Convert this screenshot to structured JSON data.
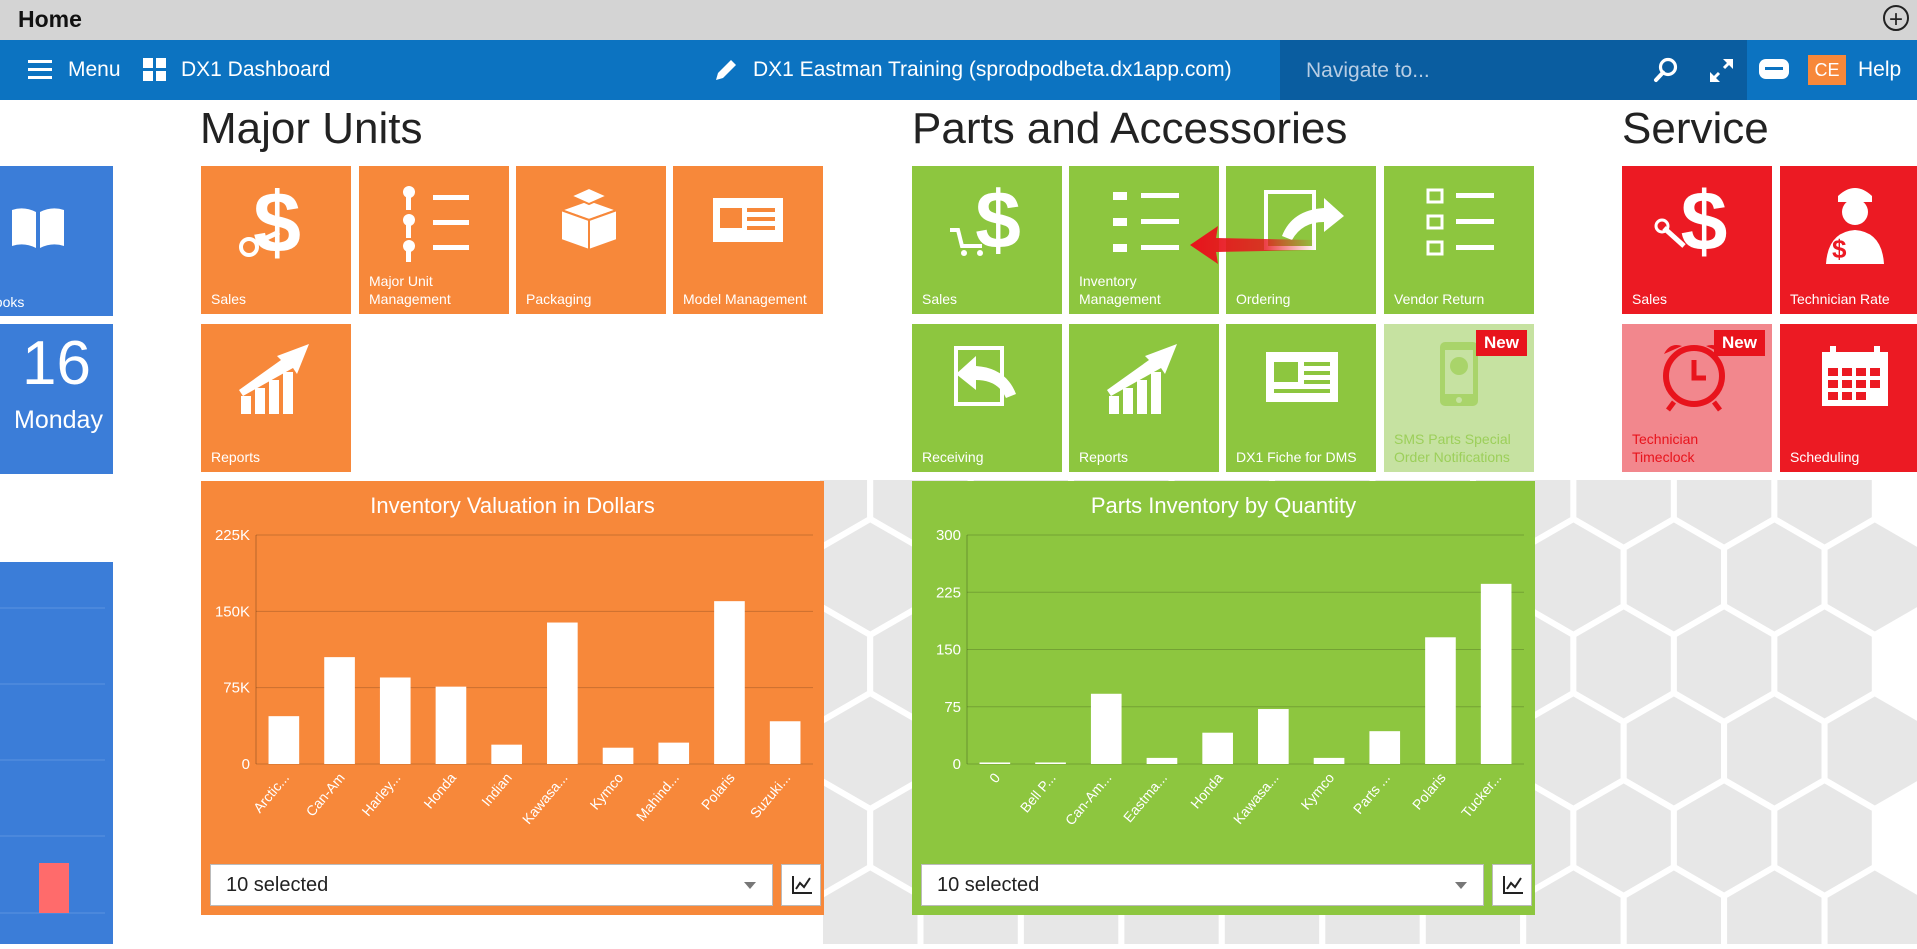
{
  "window": {
    "title": "Home",
    "add_icon": "plus-circle-icon"
  },
  "navbar": {
    "menu_label": "Menu",
    "dashboard_label": "DX1 Dashboard",
    "account_label": "DX1 Eastman Training (sprodpodbeta.dx1app.com)",
    "search_placeholder": "Navigate to...",
    "avatar_initials": "CE",
    "help_label": "Help",
    "icons": [
      "hamburger-icon",
      "grid-icon",
      "pencil-icon",
      "search-icon",
      "expand-icon",
      "chat-icon"
    ]
  },
  "left_panel": {
    "books_label": "books",
    "date_day": "16",
    "date_weekday": "Monday"
  },
  "sections": {
    "major_units": {
      "title": "Major Units",
      "tiles": [
        {
          "label": "Sales",
          "icon": "dollar-key-icon"
        },
        {
          "label": "Major Unit Management",
          "icon": "key-list-icon"
        },
        {
          "label": "Packaging",
          "icon": "boxes-icon"
        },
        {
          "label": "Model Management",
          "icon": "vehicle-card-icon"
        },
        {
          "label": "Reports",
          "icon": "growth-chart-icon"
        }
      ]
    },
    "parts": {
      "title": "Parts and Accessories",
      "tiles": [
        {
          "label": "Sales",
          "icon": "dollar-cart-icon"
        },
        {
          "label": "Inventory Management",
          "icon": "cart-list-icon"
        },
        {
          "label": "Ordering",
          "icon": "cart-forward-icon"
        },
        {
          "label": "Vendor Return",
          "icon": "return-list-icon"
        },
        {
          "label": "Receiving",
          "icon": "cart-back-icon"
        },
        {
          "label": "Reports",
          "icon": "growth-chart-icon"
        },
        {
          "label": "DX1 Fiche for DMS",
          "icon": "newspaper-icon"
        },
        {
          "label": "SMS Parts Special Order Notifications",
          "icon": "sms-phone-icon",
          "badge": "New"
        }
      ]
    },
    "service": {
      "title": "Service",
      "tiles": [
        {
          "label": "Sales",
          "icon": "dollar-wrench-icon"
        },
        {
          "label": "Technician Rate",
          "icon": "technician-icon"
        },
        {
          "label": "Technician Timeclock",
          "icon": "alarm-clock-icon",
          "badge": "New"
        },
        {
          "label": "Scheduling",
          "icon": "calendar-icon"
        }
      ]
    }
  },
  "charts": {
    "inventory_dollars": {
      "select_text": "10 selected",
      "button_icon": "line-chart-icon"
    },
    "parts_quantity": {
      "select_text": "10 selected",
      "button_icon": "line-chart-icon"
    }
  },
  "chart_data": [
    {
      "type": "bar",
      "title": "Inventory Valuation in Dollars",
      "categories": [
        "Arctic...",
        "Can-Am",
        "Harley...",
        "Honda",
        "Indian",
        "Kawasa...",
        "Kymco",
        "Mahind...",
        "Polaris",
        "Suzuki..."
      ],
      "values": [
        47000,
        105000,
        85000,
        76000,
        19000,
        139000,
        16000,
        21000,
        160000,
        42000
      ],
      "yticks": [
        "0",
        "75K",
        "150K",
        "225K"
      ],
      "ylim": [
        0,
        225000
      ],
      "grid": true,
      "color": "#f7883a"
    },
    {
      "type": "bar",
      "title": "Parts Inventory by Quantity",
      "categories": [
        "0",
        "Bell P...",
        "Can-Am...",
        "Eastma...",
        "Honda",
        "Kawasa...",
        "Kymco",
        "Parts ...",
        "Polaris",
        "Tucker..."
      ],
      "values": [
        2,
        2,
        92,
        8,
        41,
        72,
        8,
        43,
        166,
        236
      ],
      "yticks": [
        "0",
        "75",
        "150",
        "225",
        "300"
      ],
      "ylim": [
        0,
        300
      ],
      "grid": true,
      "color": "#8dc63f"
    }
  ]
}
